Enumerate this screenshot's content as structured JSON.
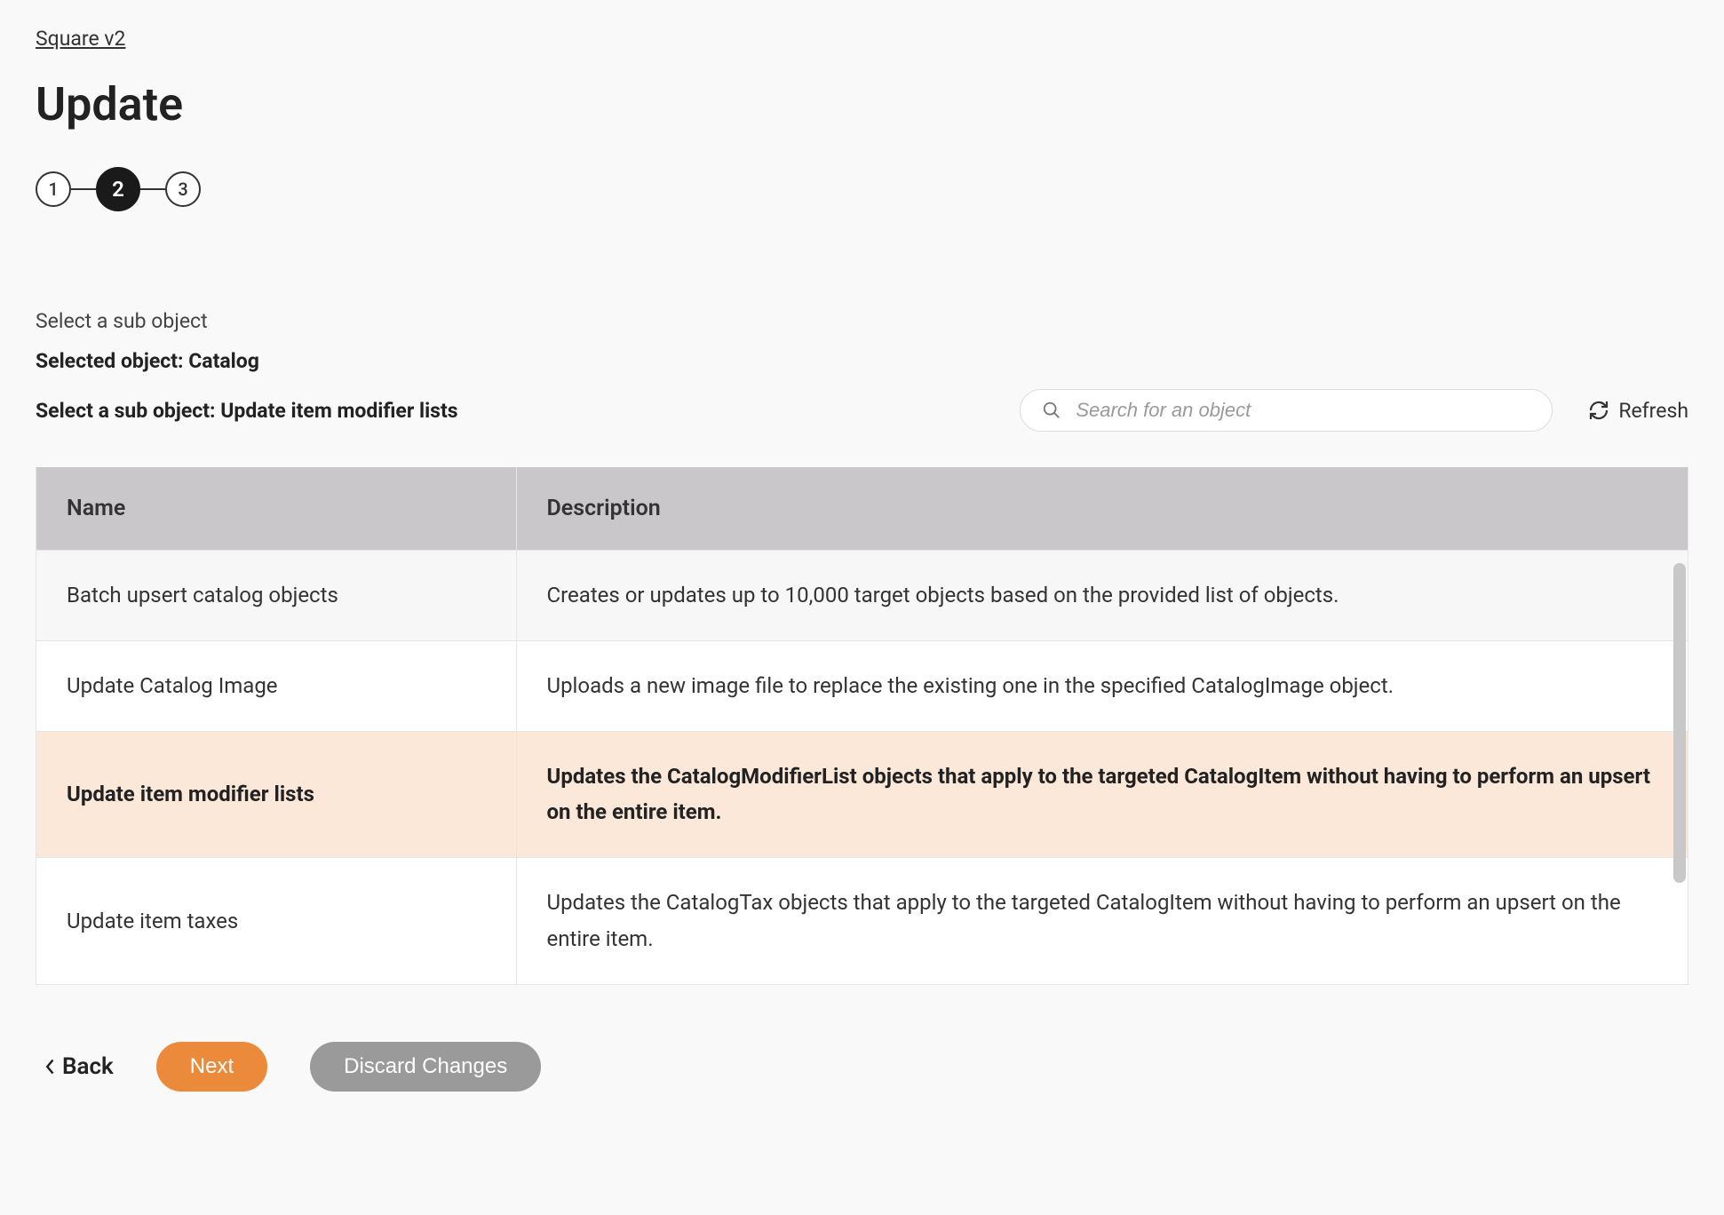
{
  "breadcrumb": "Square v2",
  "page_title": "Update",
  "stepper": {
    "steps": [
      "1",
      "2",
      "3"
    ],
    "active_index": 1
  },
  "labels": {
    "select_sub_object": "Select a sub object",
    "selected_object_prefix": "Selected object: ",
    "selected_object_value": "Catalog",
    "sub_object_prefix": "Select a sub object: ",
    "sub_object_value": "Update item modifier lists"
  },
  "search": {
    "placeholder": "Search for an object"
  },
  "refresh_label": "Refresh",
  "table": {
    "columns": {
      "name": "Name",
      "description": "Description"
    },
    "rows": [
      {
        "name": "Batch upsert catalog objects",
        "description": "Creates or updates up to 10,000 target objects based on the provided list of objects.",
        "selected": false,
        "alt": true
      },
      {
        "name": "Update Catalog Image",
        "description": "Uploads a new image file to replace the existing one in the specified CatalogImage object.",
        "selected": false,
        "alt": false
      },
      {
        "name": "Update item modifier lists",
        "description": "Updates the CatalogModifierList objects that apply to the targeted CatalogItem without having to perform an upsert on the entire item.",
        "selected": true,
        "alt": false
      },
      {
        "name": "Update item taxes",
        "description": "Updates the CatalogTax objects that apply to the targeted CatalogItem without having to perform an upsert on the entire item.",
        "selected": false,
        "alt": false
      }
    ]
  },
  "footer": {
    "back": "Back",
    "next": "Next",
    "discard": "Discard Changes"
  }
}
